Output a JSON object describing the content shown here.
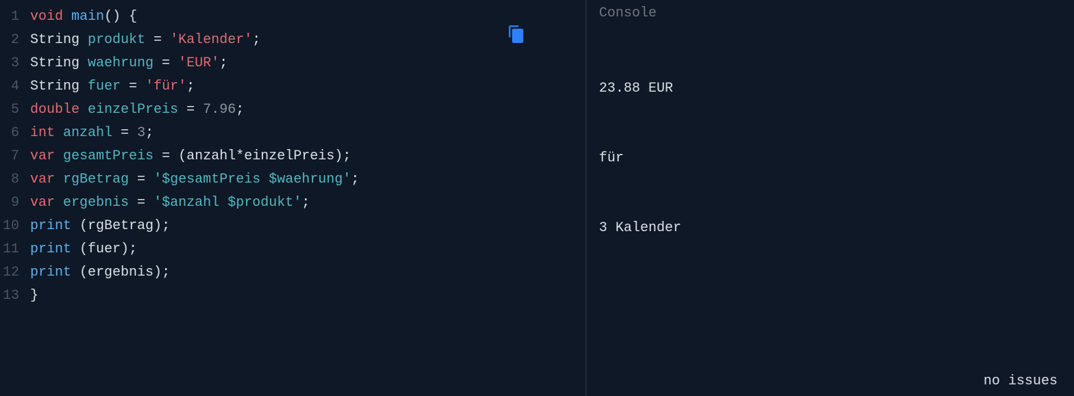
{
  "editor": {
    "lineNumbers": [
      "1",
      "2",
      "3",
      "4",
      "5",
      "6",
      "7",
      "8",
      "9",
      "10",
      "11",
      "12",
      "13"
    ],
    "code": {
      "l1": {
        "kw": "void",
        "sp": " ",
        "fn": "main",
        "paren": "() {",
        "rest": ""
      },
      "l2": {
        "type": "String",
        "sp": " ",
        "name": "produkt",
        "eq": " = ",
        "str": "'Kalender'",
        "semi": ";"
      },
      "l3": {
        "type": "String",
        "sp": " ",
        "name": "waehrung",
        "eq": " = ",
        "str": "'EUR'",
        "semi": ";"
      },
      "l4": {
        "type": "String",
        "sp": " ",
        "name": "fuer",
        "eq": " = ",
        "str": "'für'",
        "semi": ";"
      },
      "l5": {
        "type": "double",
        "sp": " ",
        "name": "einzelPreis",
        "eq": " = ",
        "num": "7.96",
        "semi": ";"
      },
      "l6": {
        "type": "int",
        "sp": " ",
        "name": "anzahl",
        "eq": " = ",
        "num": "3",
        "semi": ";"
      },
      "l7": {
        "type": "var",
        "sp": " ",
        "name": "gesamtPreis",
        "eq": " = ",
        "expr": "(anzahl*einzelPreis)",
        "semi": ";"
      },
      "l8": {
        "type": "var",
        "sp": " ",
        "name": "rgBetrag",
        "eq": " = ",
        "str": "'$gesamtPreis $waehrung'",
        "semi": ";"
      },
      "l9": {
        "type": "var",
        "sp": " ",
        "name": "ergebnis",
        "eq": " = ",
        "str": "'$anzahl $produkt'",
        "semi": ";"
      },
      "l10": {
        "fn": "print",
        "sp": " ",
        "args": "(rgBetrag)",
        "semi": ";"
      },
      "l11": {
        "fn": "print",
        "sp": " ",
        "args": "(fuer)",
        "semi": ";"
      },
      "l12": {
        "fn": "print",
        "sp": " ",
        "args": "(ergebnis)",
        "semi": ";"
      },
      "l13": {
        "brace": "}"
      }
    }
  },
  "console": {
    "title": "Console",
    "output": [
      "23.88 EUR",
      "für",
      "3 Kalender"
    ]
  },
  "status": {
    "text": "no issues"
  }
}
